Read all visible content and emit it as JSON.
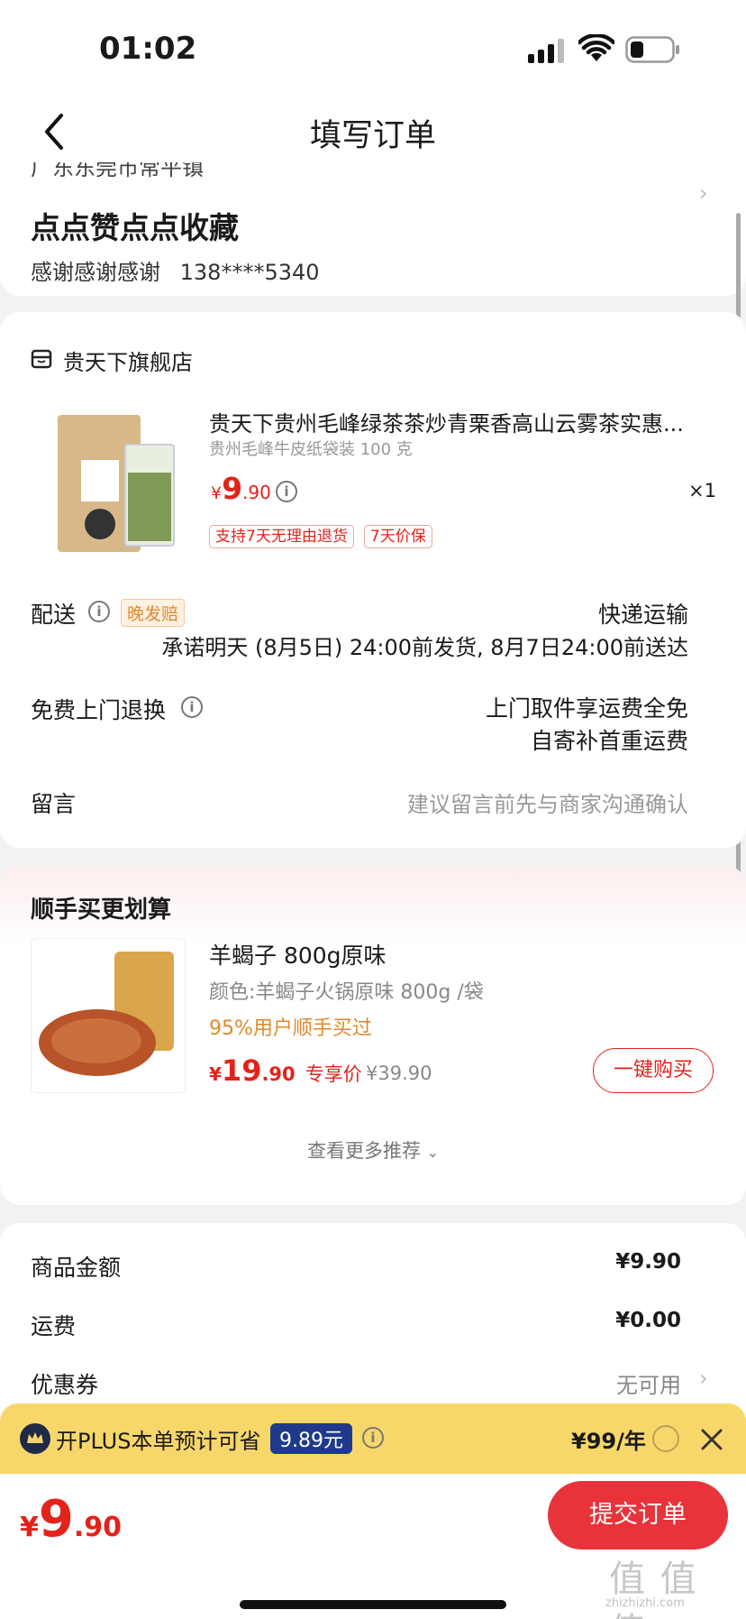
{
  "status": {
    "time": "01:02"
  },
  "header": {
    "title": "填写订单"
  },
  "address": {
    "line_partial": "广东东莞市常平镇",
    "title": "点点赞点点收藏",
    "recipient": "感谢感谢感谢",
    "phone": "138****5340"
  },
  "store": {
    "name": "贵天下旗舰店"
  },
  "product": {
    "title": "贵天下贵州毛峰绿茶茶炒青栗香高山云雾茶实惠...",
    "spec": "贵州毛峰牛皮纸袋装 100 克",
    "price_symbol": "¥",
    "price_int": "9",
    "price_dec": ".90",
    "qty": "×1",
    "tags": [
      "支持7天无理由退货",
      "7天价保"
    ]
  },
  "delivery": {
    "label": "配送",
    "badge": "晚发赔",
    "method": "快递运输",
    "promise": "承诺明天 (8月5日) 24:00前发货, 8月7日24:00前送达"
  },
  "returns": {
    "label": "免费上门退换",
    "line1": "上门取件享运费全免",
    "line2": "自寄补首重运费"
  },
  "note": {
    "label": "留言",
    "placeholder": "建议留言前先与商家沟通确认"
  },
  "recommend": {
    "title": "顺手买更划算",
    "item_title": "羊蝎子 800g原味",
    "item_spec": "颜色:羊蝎子火锅原味 800g /袋",
    "item_social": "95%用户顺手买过",
    "price_symbol": "¥",
    "price_int": "19",
    "price_dec": ".90",
    "price_label": "专享价",
    "orig_price": "¥39.90",
    "buy_label": "一键购买",
    "more_label": "查看更多推荐"
  },
  "summary": {
    "goods_label": "商品金额",
    "goods_value": "¥9.90",
    "shipping_label": "运费",
    "shipping_value": "¥0.00",
    "coupon_label": "优惠券",
    "coupon_value": "无可用"
  },
  "plus_bar": {
    "text": "开PLUS本单预计可省",
    "save_amount": "9.89元",
    "price": "¥99/年"
  },
  "footer": {
    "total_symbol": "¥",
    "total_int": "9",
    "total_dec": ".90",
    "submit_label": "提交订单"
  },
  "watermark": "值 值 值",
  "watermark_sub": "zhizhizhi.com",
  "colors": {
    "accent": "#e2231a",
    "plus_bg": "#f8d76a",
    "plus_badge": "#1f3a8a"
  }
}
